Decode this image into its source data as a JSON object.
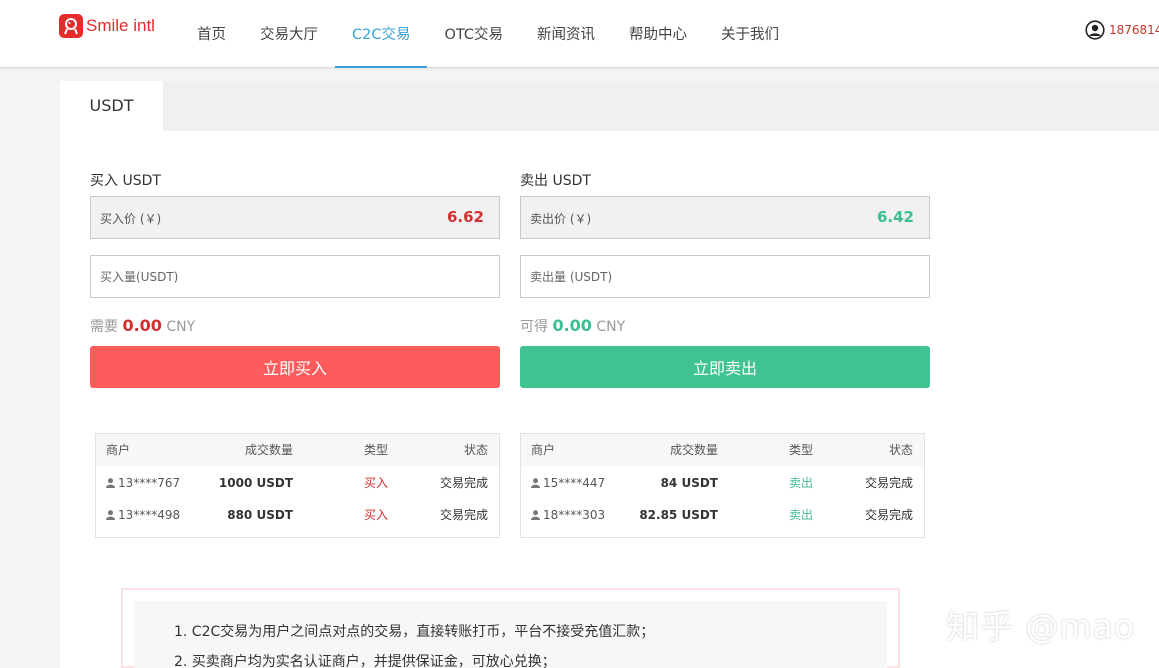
{
  "brand": {
    "name": "Smile intl",
    "color": "#e52b2b"
  },
  "nav": {
    "items": [
      {
        "label": "首页"
      },
      {
        "label": "交易大厅"
      },
      {
        "label": "C2C交易",
        "active": true
      },
      {
        "label": "OTC交易"
      },
      {
        "label": "新闻资讯"
      },
      {
        "label": "帮助中心"
      },
      {
        "label": "关于我们"
      }
    ]
  },
  "user": {
    "name": "1876814"
  },
  "tabs": [
    {
      "label": "USDT",
      "active": true
    }
  ],
  "buy": {
    "title": "买入 USDT",
    "price_label": "买入价 (￥)",
    "price": "6.62",
    "amount_placeholder": "买入量(USDT)",
    "total_prefix": "需要",
    "total_value": "0.00",
    "total_unit": "CNY",
    "button_label": "立即买入",
    "button_color": "#fc5c5c"
  },
  "sell": {
    "title": "卖出 USDT",
    "price_label": "卖出价 (￥)",
    "price": "6.42",
    "amount_placeholder": "卖出量 (USDT)",
    "total_prefix": "可得",
    "total_value": "0.00",
    "total_unit": "CNY",
    "button_label": "立即卖出",
    "button_color": "#41c391"
  },
  "buy_orders": {
    "headers": [
      "商户",
      "成交数量",
      "类型",
      "状态"
    ],
    "rows": [
      {
        "merchant": "13****767",
        "amount": "1000  USDT",
        "type": "买入",
        "status": "交易完成"
      },
      {
        "merchant": "13****498",
        "amount": "880  USDT",
        "type": "买入",
        "status": "交易完成"
      }
    ]
  },
  "sell_orders": {
    "headers": [
      "商户",
      "成交数量",
      "类型",
      "状态"
    ],
    "rows": [
      {
        "merchant": "15****447",
        "amount": "84  USDT",
        "type": "卖出",
        "status": "交易完成"
      },
      {
        "merchant": "18****303",
        "amount": "82.85  USDT",
        "type": "卖出",
        "status": "交易完成"
      }
    ]
  },
  "notice": {
    "lines": [
      "1. C2C交易为用户之间点对点的交易，直接转账打币，平台不接受充值汇款；",
      "2. 买卖商户均为实名认证商户，并提供保证金，可放心兑换；"
    ]
  },
  "watermark": "知乎 @mao",
  "icons": {
    "user": "user-circle-icon",
    "merchant": "person-icon",
    "logo": "logo-icon"
  }
}
